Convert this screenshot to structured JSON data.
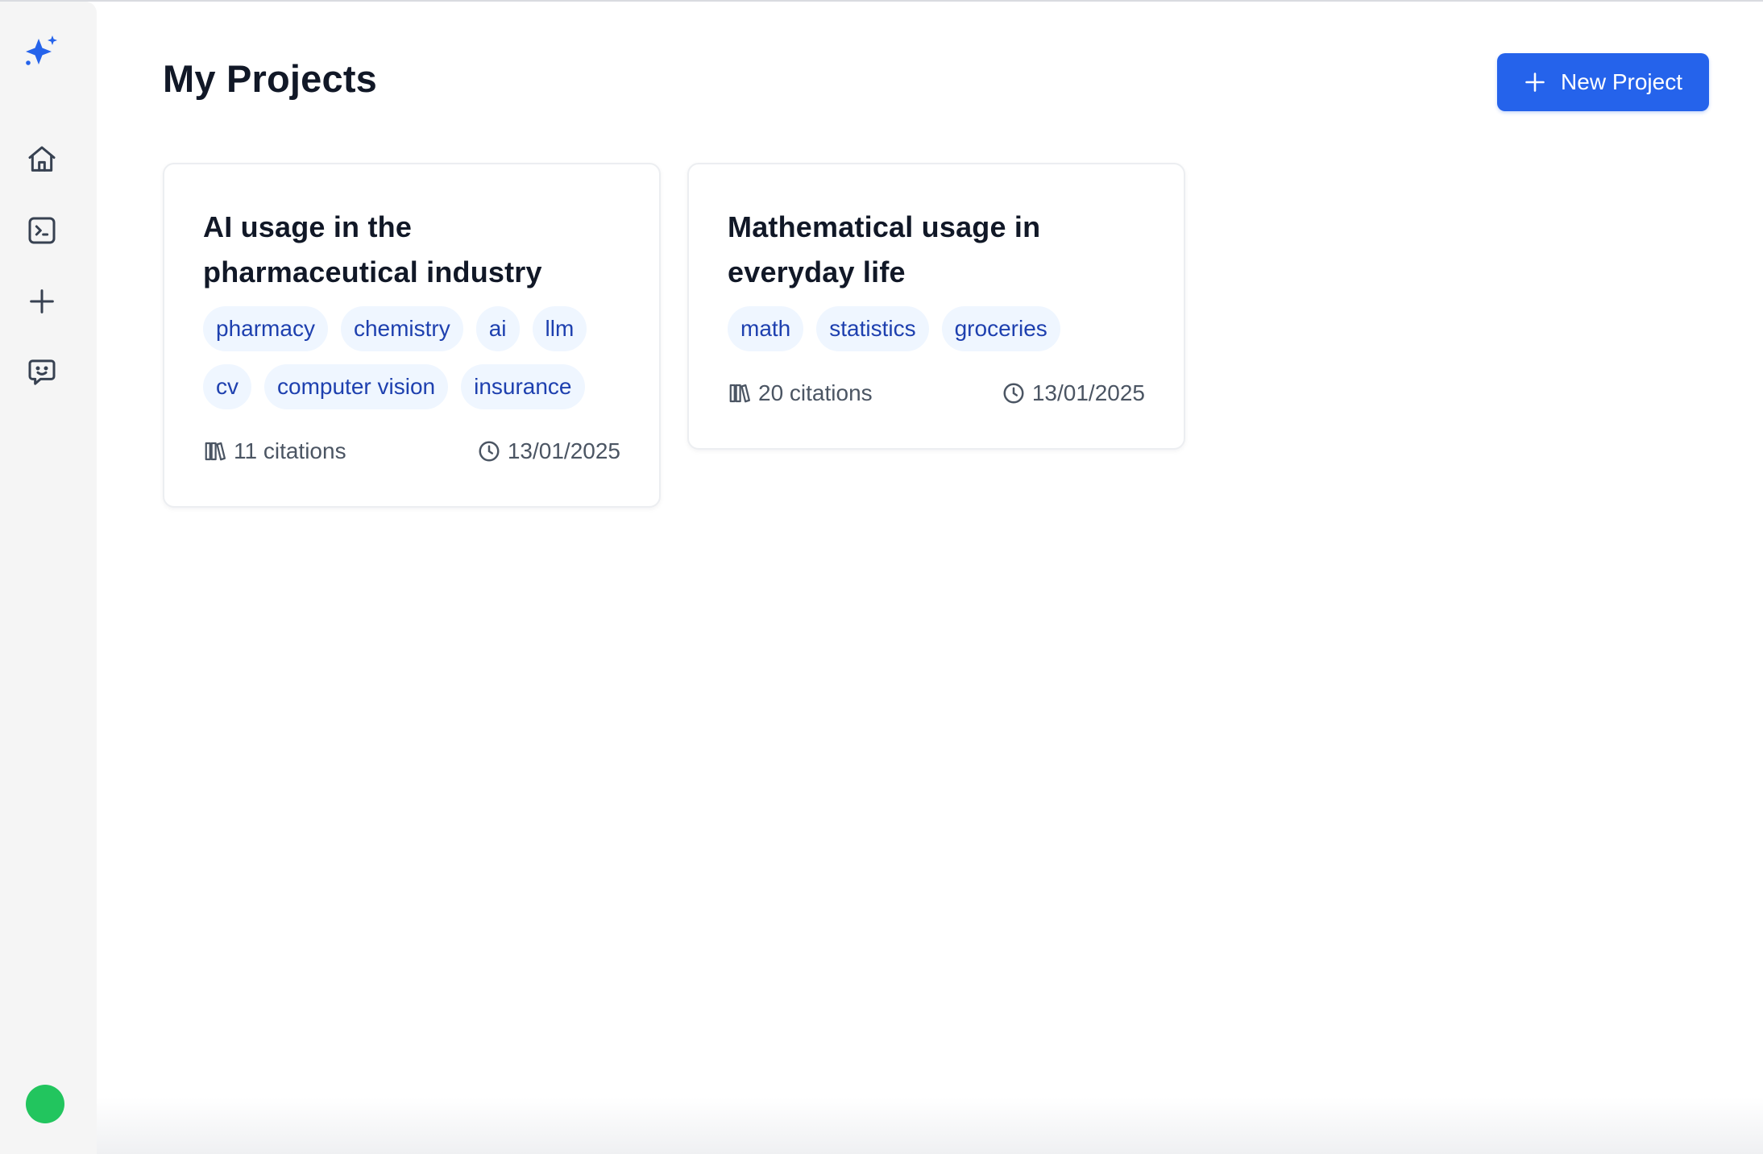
{
  "sidebar": {
    "logo_icon": "sparkles-icon",
    "items": [
      {
        "name": "home",
        "icon": "home-icon"
      },
      {
        "name": "terminal",
        "icon": "terminal-icon"
      },
      {
        "name": "add",
        "icon": "plus-icon"
      },
      {
        "name": "chat",
        "icon": "chat-smile-icon"
      }
    ],
    "status_color": "#22c55e"
  },
  "header": {
    "title": "My Projects",
    "new_project_label": "New Project",
    "accent_color": "#2563eb"
  },
  "projects": [
    {
      "title": "AI usage in the pharmaceutical industry",
      "tags": [
        "pharmacy",
        "chemistry",
        "ai",
        "llm",
        "cv",
        "computer vision",
        "insurance"
      ],
      "citations": "11 citations",
      "date": "13/01/2025"
    },
    {
      "title": "Mathematical usage in everyday life",
      "tags": [
        "math",
        "statistics",
        "groceries"
      ],
      "citations": "20 citations",
      "date": "13/01/2025"
    }
  ]
}
